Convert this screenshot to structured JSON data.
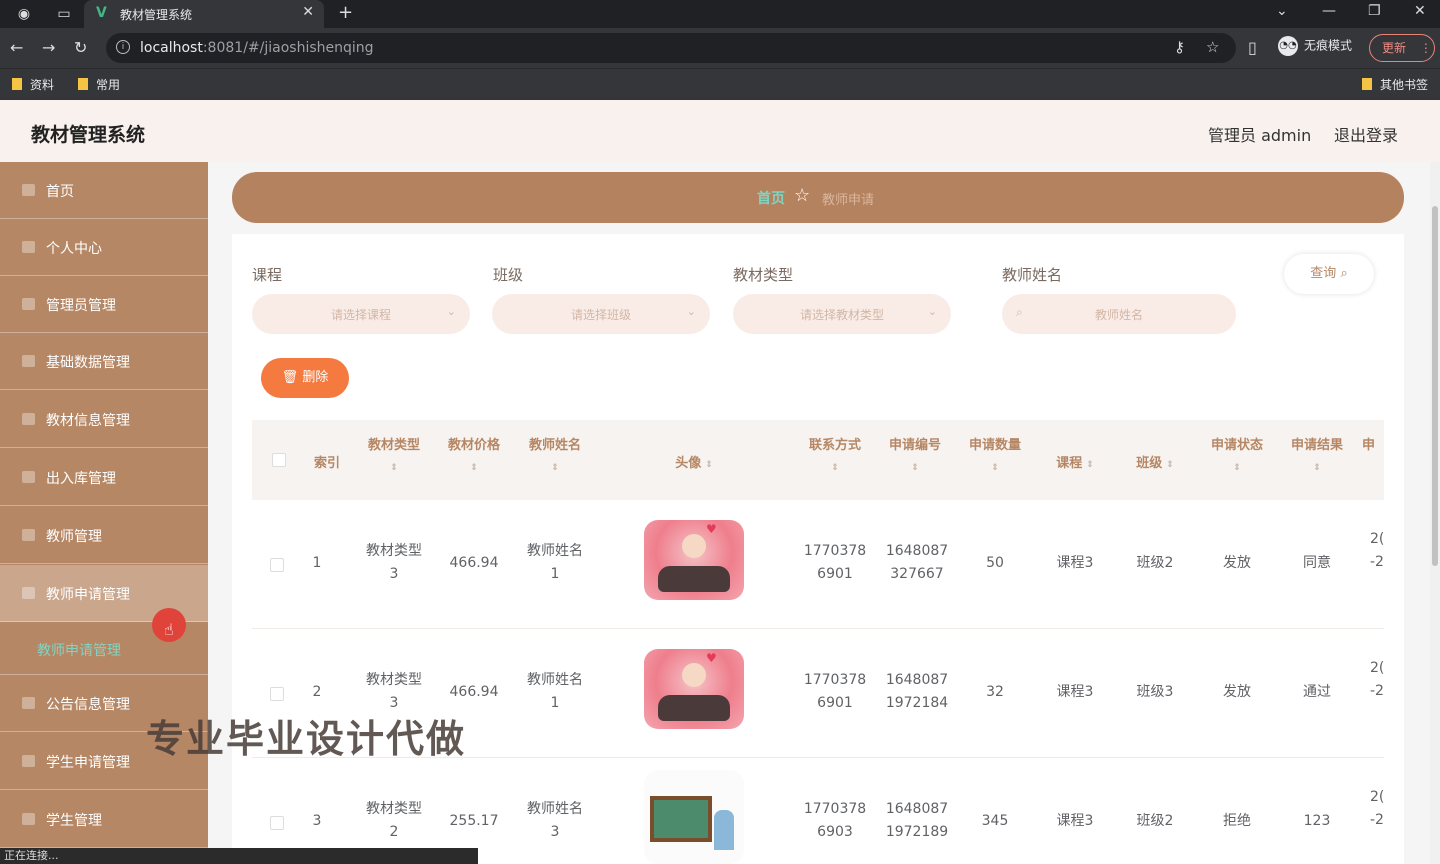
{
  "browser": {
    "tab_title": "教材管理系统",
    "url_host": "localhost",
    "url_rest": ":8081/#/jiaoshishenqing",
    "incognito_label": "无痕模式",
    "update_label": "更新",
    "bookmarks": [
      "资料",
      "常用"
    ],
    "other_bookmarks": "其他书签",
    "status_text": "正在连接..."
  },
  "header": {
    "title": "教材管理系统",
    "user": "管理员 admin",
    "logout": "退出登录"
  },
  "sidebar": {
    "items": [
      "首页",
      "个人中心",
      "管理员管理",
      "基础数据管理",
      "教材信息管理",
      "出入库管理",
      "教师管理",
      "教师申请管理",
      "公告信息管理",
      "学生申请管理",
      "学生管理"
    ],
    "active_index": 7,
    "sub_item": "教师申请管理"
  },
  "breadcrumb": {
    "home": "首页",
    "current": "教师申请"
  },
  "filters": [
    {
      "label": "课程",
      "placeholder": "请选择课程"
    },
    {
      "label": "班级",
      "placeholder": "请选择班级"
    },
    {
      "label": "教材类型",
      "placeholder": "请选择教材类型"
    },
    {
      "label": "教师姓名",
      "placeholder": "教师姓名"
    }
  ],
  "buttons": {
    "query": "查询",
    "delete": "删除"
  },
  "table": {
    "headers": [
      "索引",
      "教材类型",
      "教材价格",
      "教师姓名",
      "头像",
      "联系方式",
      "申请编号",
      "申请数量",
      "课程",
      "班级",
      "申请状态",
      "申请结果",
      "申"
    ],
    "rows": [
      {
        "index": "1",
        "type_a": "教材类型",
        "type_b": "3",
        "price": "466.94",
        "teacher_a": "教师姓名",
        "teacher_b": "1",
        "phone_a": "1770378",
        "phone_b": "6901",
        "no_a": "1648087",
        "no_b": "327667",
        "qty": "50",
        "course": "课程3",
        "cls": "班级2",
        "status": "发放",
        "result": "同意",
        "date_a": "2(",
        "date_b": "-2",
        "avatar": "pink"
      },
      {
        "index": "2",
        "type_a": "教材类型",
        "type_b": "3",
        "price": "466.94",
        "teacher_a": "教师姓名",
        "teacher_b": "1",
        "phone_a": "1770378",
        "phone_b": "6901",
        "no_a": "1648087",
        "no_b": "1972184",
        "qty": "32",
        "course": "课程3",
        "cls": "班级3",
        "status": "发放",
        "result": "通过",
        "date_a": "2(",
        "date_b": "-2",
        "avatar": "pink"
      },
      {
        "index": "3",
        "type_a": "教材类型",
        "type_b": "2",
        "price": "255.17",
        "teacher_a": "教师姓名",
        "teacher_b": "3",
        "phone_a": "1770378",
        "phone_b": "6903",
        "no_a": "1648087",
        "no_b": "1972189",
        "qty": "345",
        "course": "课程3",
        "cls": "班级2",
        "status": "拒绝",
        "result": "123",
        "date_a": "2(",
        "date_b": "-2",
        "avatar": "board"
      }
    ]
  },
  "watermark": "专业毕业设计代做",
  "colors": {
    "sidebar": "#b68765",
    "breadcrumb": "#b5825f",
    "accent_teal": "#7fd4c4",
    "delete": "#f47a3f"
  }
}
